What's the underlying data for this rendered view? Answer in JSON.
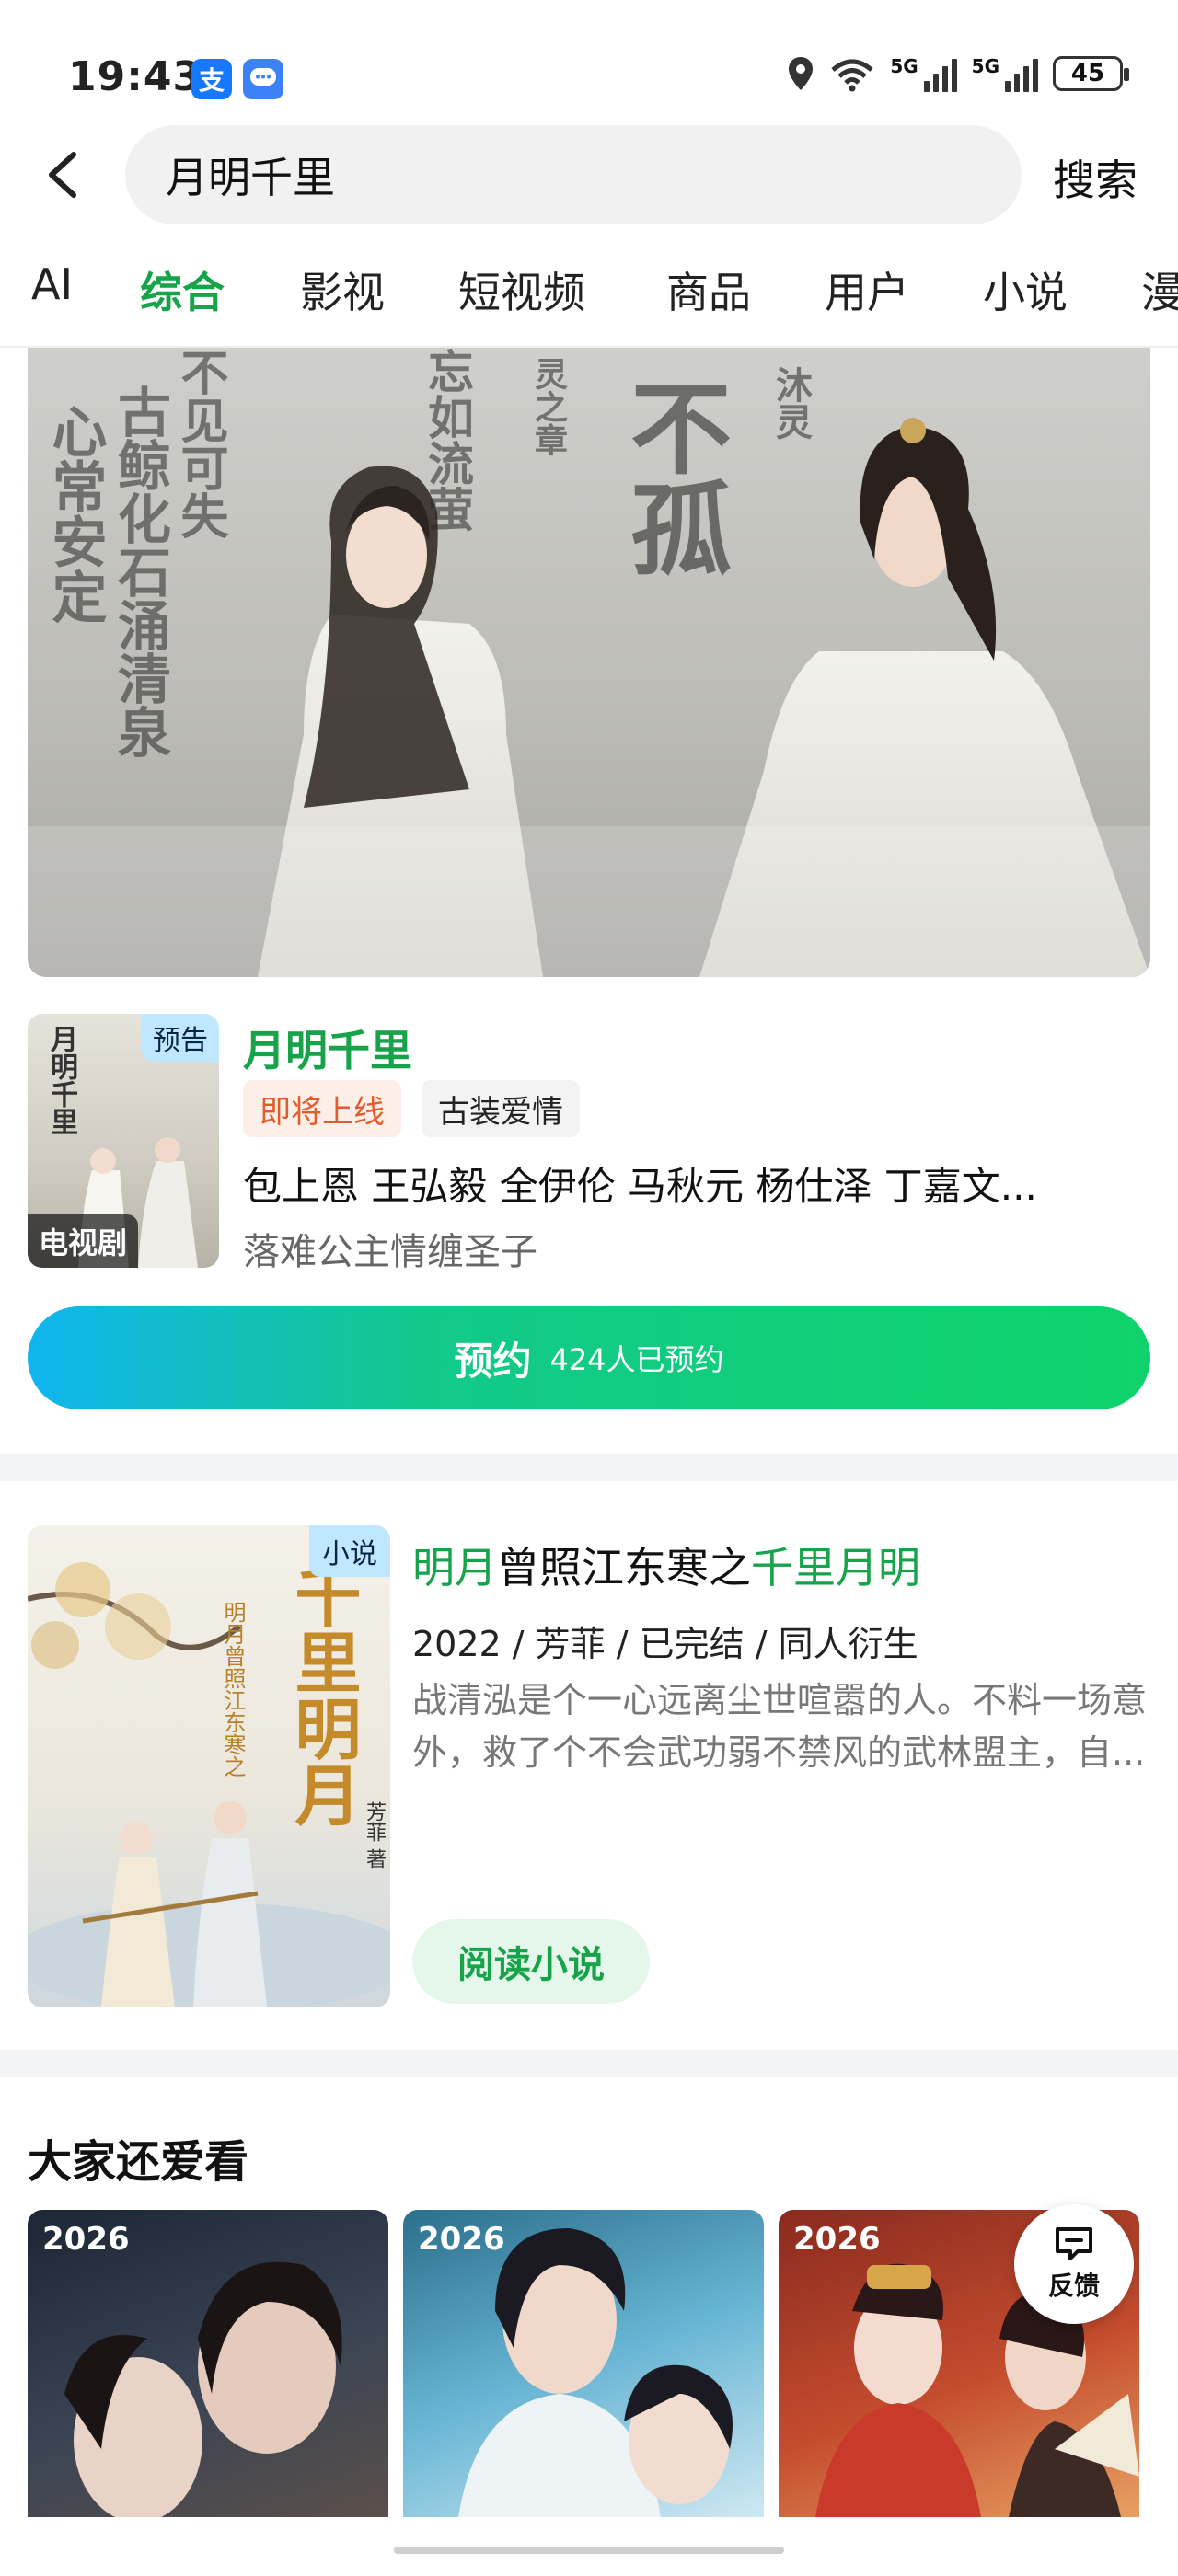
{
  "status_bar": {
    "time": "19:43",
    "app_icons": [
      "支",
      "message-icon"
    ],
    "network_1": "5G",
    "network_2": "5G",
    "battery": "45"
  },
  "search": {
    "query": "月明千里",
    "button": "搜索"
  },
  "tabs": [
    "AI",
    "综合",
    "影视",
    "短视频",
    "商品",
    "用户",
    "小说",
    "漫"
  ],
  "active_tab": "综合",
  "hero": {
    "calligraphy": [
      "不孤",
      "心常安定",
      "古鲸化石涌清泉",
      "不见可失",
      "忘如流萤",
      "灵之章",
      "沐灵"
    ]
  },
  "drama": {
    "poster_badge": "预告",
    "poster_type": "电视剧",
    "poster_title_text": "月明千里",
    "title": "月明千里",
    "tags": [
      "即将上线",
      "古装爱情"
    ],
    "cast": "包上恩  王弘毅  全伊伦  马秋元  杨仕泽  丁嘉文...",
    "description": "落难公主情缠圣子",
    "reserve_button": "预约",
    "reserve_count": "424人已预约"
  },
  "novel": {
    "badge": "小说",
    "cover_title": "千里明月",
    "cover_author": "芳菲 著",
    "cover_subtitle": "明月曾照江东寒之",
    "title_parts": [
      "明月",
      "曾照江东寒之",
      "千里月明"
    ],
    "meta": "2022 / 芳菲 / 已完结 / 同人衍生",
    "description": "战清泓是个一心远离尘世喧嚣的人。不料一场意外，救了个不会武功弱不禁风的武林盟主，自...",
    "read_button": "阅读小说"
  },
  "recommend": {
    "title": "大家还爱看",
    "items": [
      {
        "year": "2026"
      },
      {
        "year": "2026"
      },
      {
        "year": "2026"
      }
    ]
  },
  "feedback": "反馈",
  "colors": {
    "accent": "#16a34a",
    "coming_tag": "#e25b2a",
    "badge_bg": "#bfe7ff"
  }
}
